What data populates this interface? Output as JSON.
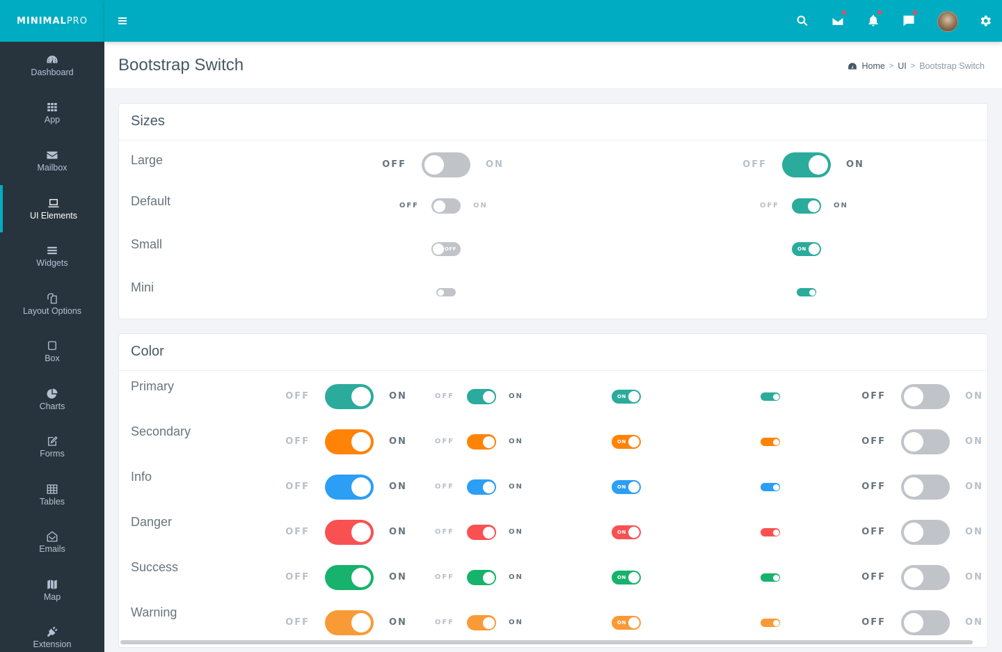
{
  "brand": {
    "bold": "MINIMAL",
    "light": "PRO"
  },
  "topbar": {
    "icons": [
      "search-icon",
      "mail-icon",
      "bell-icon",
      "chat-icon",
      "avatar",
      "gear-icon"
    ],
    "notification_dots": [
      "mail",
      "bell",
      "chat"
    ],
    "accent": "#00acc1"
  },
  "sidebar": {
    "items": [
      {
        "label": "Dashboard",
        "icon": "dashboard-icon",
        "active": false
      },
      {
        "label": "App",
        "icon": "grid-icon",
        "active": false
      },
      {
        "label": "Mailbox",
        "icon": "envelope-icon",
        "active": false
      },
      {
        "label": "UI Elements",
        "icon": "laptop-icon",
        "active": true
      },
      {
        "label": "Widgets",
        "icon": "bars-icon",
        "active": false
      },
      {
        "label": "Layout Options",
        "icon": "copy-icon",
        "active": false
      },
      {
        "label": "Box",
        "icon": "square-icon",
        "active": false
      },
      {
        "label": "Charts",
        "icon": "pie-chart-icon",
        "active": false
      },
      {
        "label": "Forms",
        "icon": "edit-icon",
        "active": false
      },
      {
        "label": "Tables",
        "icon": "table-icon",
        "active": false
      },
      {
        "label": "Emails",
        "icon": "envelope-open-icon",
        "active": false
      },
      {
        "label": "Map",
        "icon": "map-icon",
        "active": false
      },
      {
        "label": "Extension",
        "icon": "plug-icon",
        "active": false
      }
    ]
  },
  "header": {
    "title": "Bootstrap Switch",
    "breadcrumb": [
      "Home",
      "UI",
      "Bootstrap Switch"
    ]
  },
  "sizes_card": {
    "title": "Sizes",
    "rows": [
      {
        "label": "Large",
        "size": "large"
      },
      {
        "label": "Default",
        "size": "default"
      },
      {
        "label": "Small",
        "size": "small"
      },
      {
        "label": "Mini",
        "size": "mini"
      }
    ],
    "off_label": "OFF",
    "on_label": "ON",
    "left_state": "off",
    "right_state": "on"
  },
  "color_card": {
    "title": "Color",
    "off_label": "OFF",
    "on_label": "ON",
    "rows": [
      {
        "label": "Primary",
        "color": "#2bab9c"
      },
      {
        "label": "Secondary",
        "color": "#ff8306"
      },
      {
        "label": "Info",
        "color": "#2b9ef5"
      },
      {
        "label": "Danger",
        "color": "#f95152"
      },
      {
        "label": "Success",
        "color": "#17b26c"
      },
      {
        "label": "Warning",
        "color": "#f89b36"
      }
    ],
    "columns": [
      {
        "size": "large",
        "state": "on"
      },
      {
        "size": "default",
        "state": "on"
      },
      {
        "size": "small",
        "state": "on"
      },
      {
        "size": "mini",
        "state": "on"
      },
      {
        "size": "large",
        "state": "off"
      }
    ]
  },
  "colors": {
    "off_track": "#c0c4c9",
    "sizes_on": "#2bab9c"
  }
}
